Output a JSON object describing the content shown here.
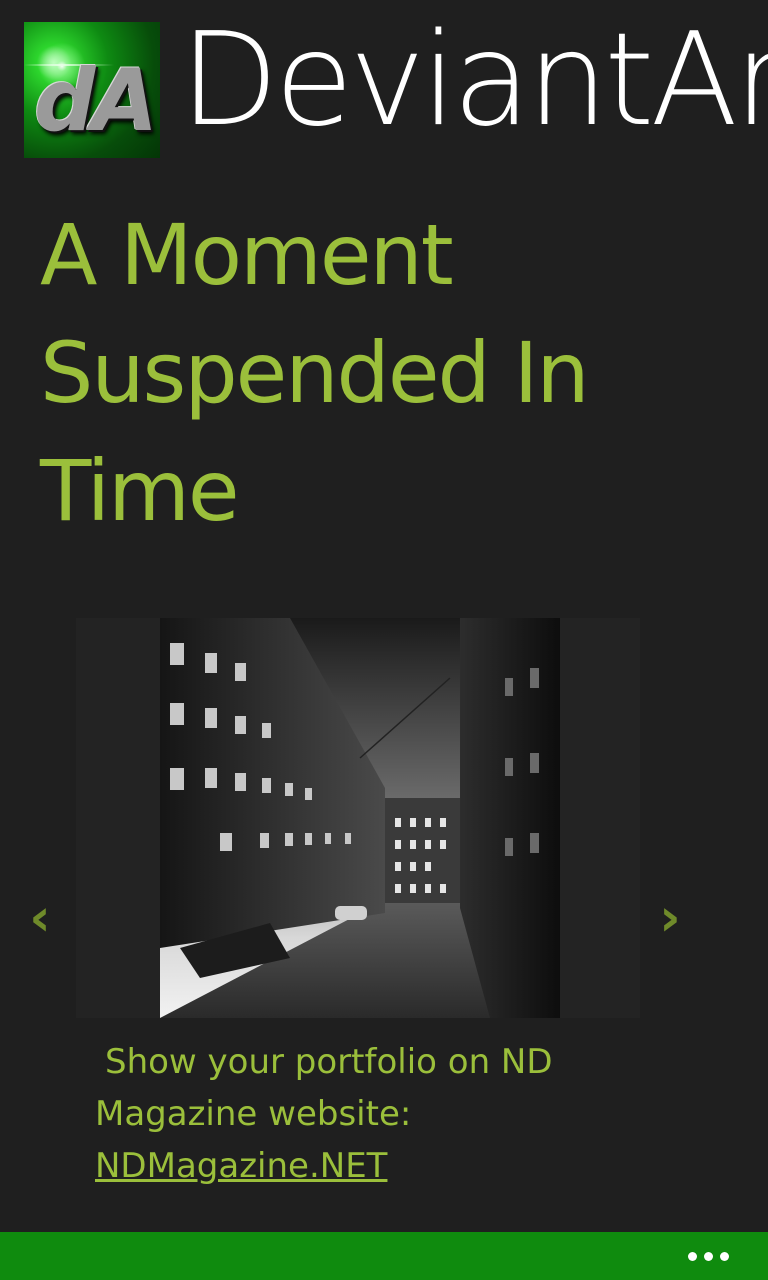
{
  "header": {
    "app_title": "DeviantArt",
    "logo_text": "dA"
  },
  "article": {
    "title": "A Moment Suspended In Time",
    "image_alt": "Black and white photo of a dark alley between old buildings",
    "description_line1": "Show your portfolio on ND",
    "description_line2": "Magazine website:",
    "link_text": "NDMagazine.NET"
  },
  "navigation": {
    "prev_icon": "chevron-left-icon",
    "next_icon": "chevron-right-icon",
    "prev_glyph": "‹",
    "next_glyph": "›"
  },
  "app_bar": {
    "more_icon": "ellipsis-icon"
  },
  "colors": {
    "background": "#1f1f1f",
    "accent_text": "#9bbf3b",
    "arrow": "#6f8a2a",
    "app_bar": "#0f8b0e"
  }
}
